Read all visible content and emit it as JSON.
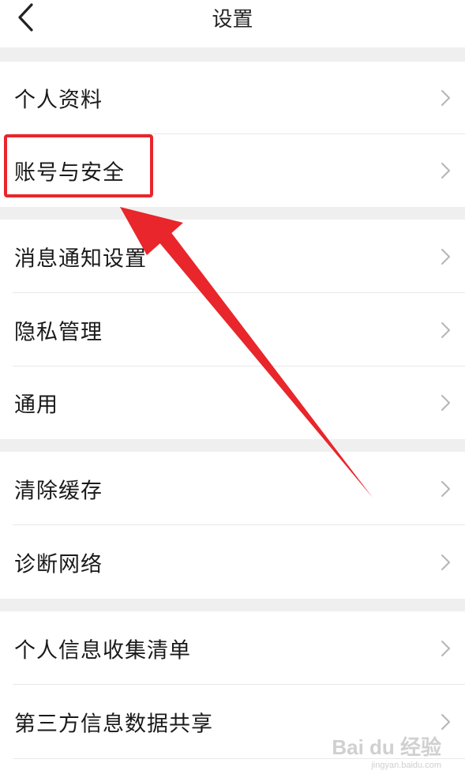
{
  "header": {
    "title": "设置"
  },
  "groups": [
    {
      "items": [
        "个人资料",
        "账号与安全"
      ]
    },
    {
      "items": [
        "消息通知设置",
        "隐私管理",
        "通用"
      ]
    },
    {
      "items": [
        "清除缓存",
        "诊断网络"
      ]
    },
    {
      "items": [
        "个人信息收集清单",
        "第三方信息数据共享"
      ]
    }
  ],
  "watermark": {
    "brand": "Bai du 经验",
    "url": "jingyan.baidu.com"
  },
  "colors": {
    "annotation": "#e8262b",
    "separator": "#efefef"
  }
}
